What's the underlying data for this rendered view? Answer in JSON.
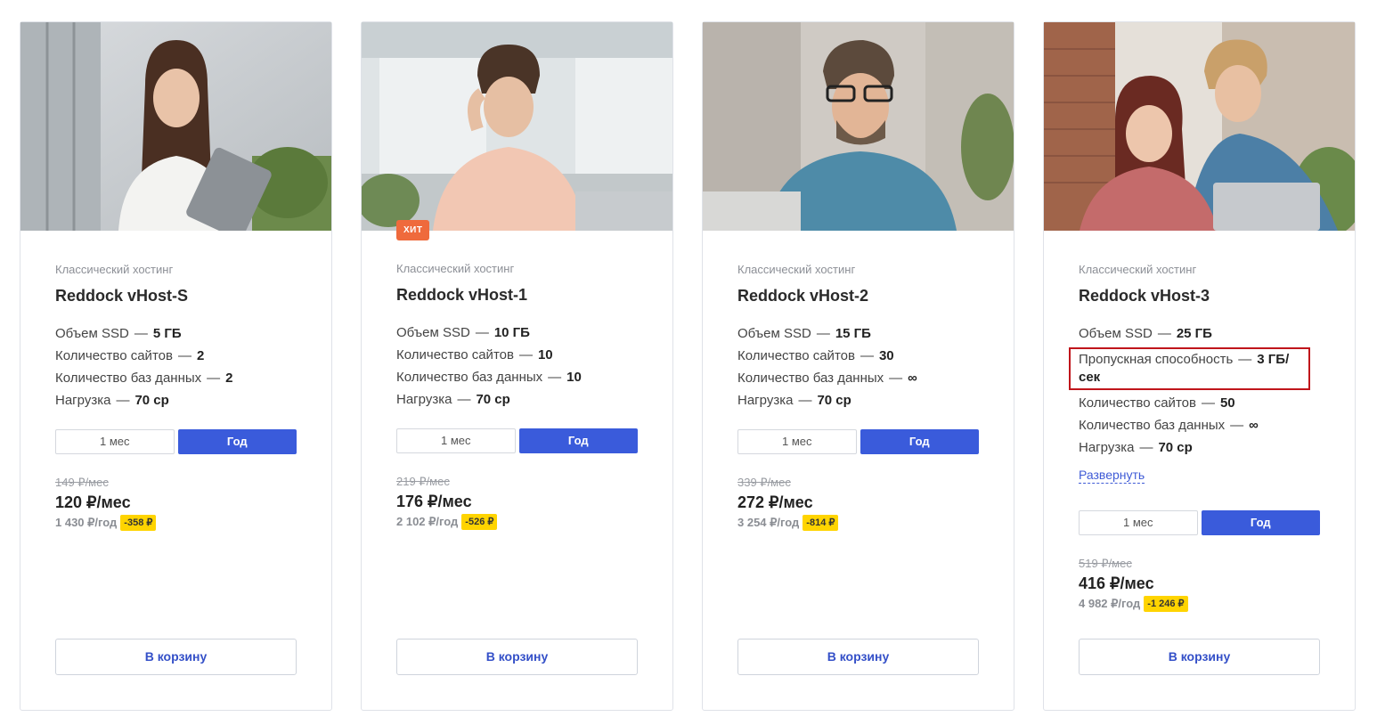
{
  "plans": [
    {
      "category": "Классический хостинг",
      "title": "Reddock vHost-S",
      "badge": "",
      "specs": [
        {
          "label": "Объем SSD",
          "value": "5 ГБ"
        },
        {
          "label": "Количество сайтов",
          "value": "2"
        },
        {
          "label": "Количество баз данных",
          "value": "2"
        },
        {
          "label": "Нагрузка",
          "value": "70 cp"
        }
      ],
      "period_month": "1 мес",
      "period_year": "Год",
      "old_price": "149 ₽/мес",
      "price": "120 ₽/мес",
      "year_price": "1 430 ₽/год",
      "discount": "-358 ₽",
      "cart": "В корзину"
    },
    {
      "category": "Классический хостинг",
      "title": "Reddock vHost-1",
      "badge": "ХИТ",
      "specs": [
        {
          "label": "Объем SSD",
          "value": "10 ГБ"
        },
        {
          "label": "Количество сайтов",
          "value": "10"
        },
        {
          "label": "Количество баз данных",
          "value": "10"
        },
        {
          "label": "Нагрузка",
          "value": "70 cp"
        }
      ],
      "period_month": "1 мес",
      "period_year": "Год",
      "old_price": "219 ₽/мес",
      "price": "176 ₽/мес",
      "year_price": "2 102 ₽/год",
      "discount": "-526 ₽",
      "cart": "В корзину"
    },
    {
      "category": "Классический хостинг",
      "title": "Reddock vHost-2",
      "badge": "",
      "specs": [
        {
          "label": "Объем SSD",
          "value": "15 ГБ"
        },
        {
          "label": "Количество сайтов",
          "value": "30"
        },
        {
          "label": "Количество баз данных",
          "value": "∞"
        },
        {
          "label": "Нагрузка",
          "value": "70 cp"
        }
      ],
      "period_month": "1 мес",
      "period_year": "Год",
      "old_price": "339 ₽/мес",
      "price": "272 ₽/мес",
      "year_price": "3 254 ₽/год",
      "discount": "-814 ₽",
      "cart": "В корзину"
    },
    {
      "category": "Классический хостинг",
      "title": "Reddock vHost-3",
      "badge": "",
      "specs": [
        {
          "label": "Объем SSD",
          "value": "25 ГБ"
        },
        {
          "label": "Пропускная способность",
          "value": "3 ГБ/сек"
        },
        {
          "label": "Количество сайтов",
          "value": "50"
        },
        {
          "label": "Количество баз данных",
          "value": "∞"
        },
        {
          "label": "Нагрузка",
          "value": "70 cp"
        }
      ],
      "expand": "Развернуть",
      "period_month": "1 мес",
      "period_year": "Год",
      "old_price": "519 ₽/мес",
      "price": "416 ₽/мес",
      "year_price": "4 982 ₽/год",
      "discount": "-1 246 ₽",
      "cart": "В корзину"
    }
  ],
  "colors": {
    "accent": "#3a5bdb",
    "badge": "#ef6a3c",
    "discount": "#ffd400",
    "highlight": "#c0151b"
  }
}
